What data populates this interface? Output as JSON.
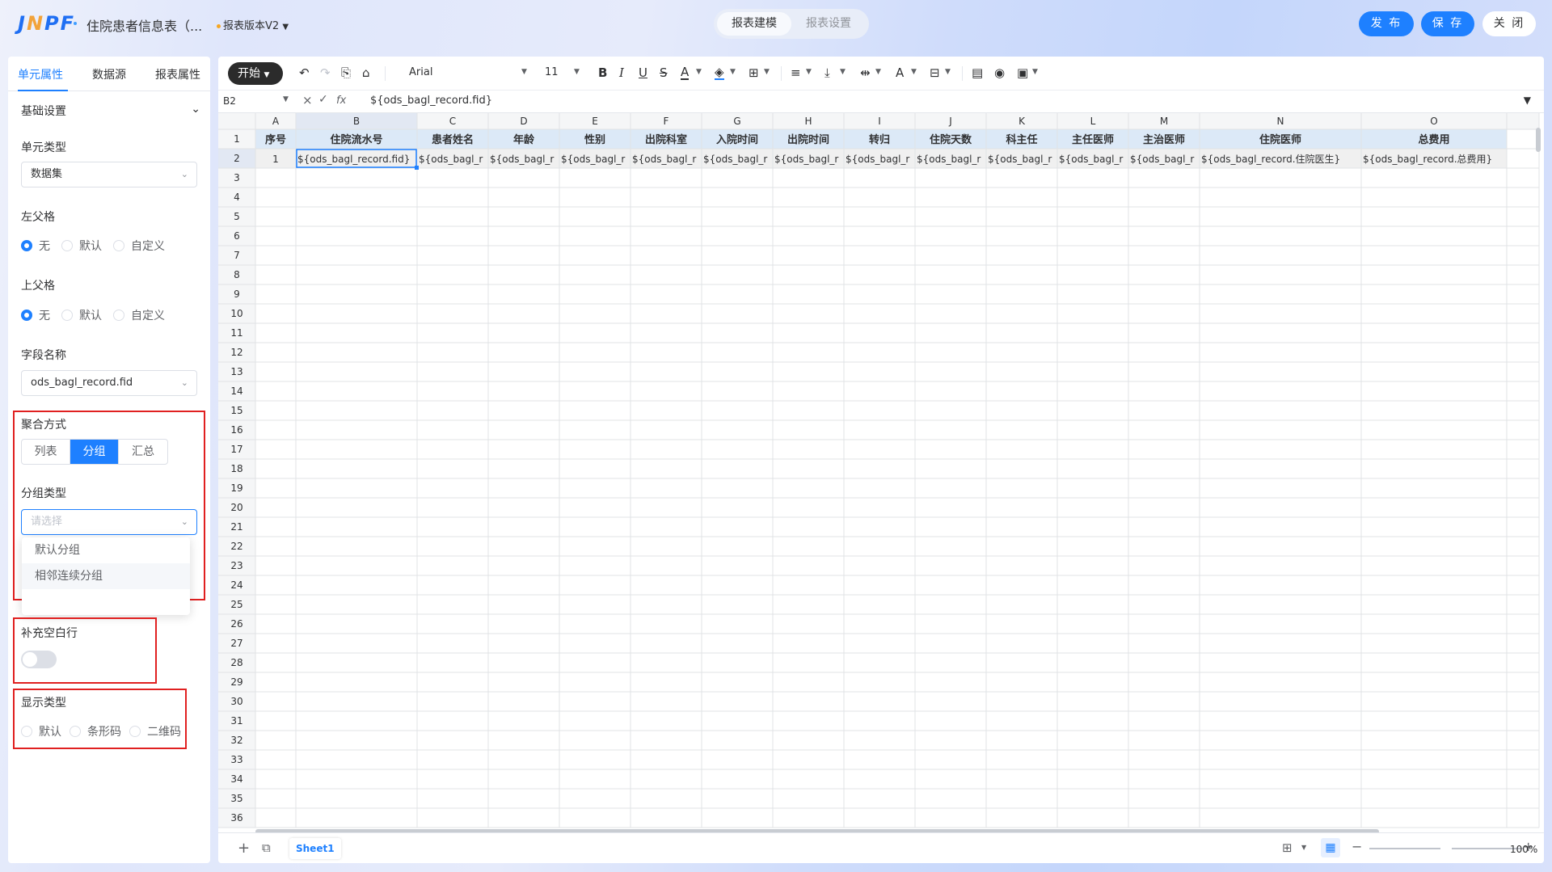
{
  "app": {
    "logo_prefix": "J",
    "logo_accent": "N",
    "logo_suffix": "PF",
    "doc_title": "住院患者信息表（...",
    "version_label": "报表版本V2",
    "mode_tabs": [
      "报表建模",
      "报表设置"
    ],
    "publish_label": "发 布",
    "save_label": "保 存",
    "close_label": "关 闭"
  },
  "left_panel": {
    "tabs": [
      "单元属性",
      "数据源",
      "报表属性"
    ],
    "section_title": "基础设置",
    "cell_type_label": "单元类型",
    "cell_type_value": "数据集",
    "left_parent_label": "左父格",
    "left_parent_options": [
      "无",
      "默认",
      "自定义"
    ],
    "top_parent_label": "上父格",
    "top_parent_options": [
      "无",
      "默认",
      "自定义"
    ],
    "field_name_label": "字段名称",
    "field_name_value": "ods_bagl_record.fid",
    "aggregate_label": "聚合方式",
    "aggregate_options": [
      "列表",
      "分组",
      "汇总"
    ],
    "group_type_label": "分组类型",
    "group_type_placeholder": "请选择",
    "group_type_options": [
      "默认分组",
      "相邻连续分组"
    ],
    "fill_blank_label": "补充空白行",
    "display_type_label": "显示类型",
    "display_type_options": [
      "默认",
      "条形码",
      "二维码"
    ]
  },
  "toolbar": {
    "start_label": "开始",
    "font_family": "Arial",
    "font_size": "11"
  },
  "formula_bar": {
    "cell_ref": "B2",
    "fx_label": "fx",
    "formula": "${ods_bagl_record.fid}"
  },
  "sheet": {
    "columns": [
      "A",
      "B",
      "C",
      "D",
      "E",
      "F",
      "G",
      "H",
      "I",
      "J",
      "K",
      "L",
      "M",
      "N",
      "O"
    ],
    "header_row": [
      "序号",
      "住院流水号",
      "患者姓名",
      "年龄",
      "性别",
      "出院科室",
      "入院时间",
      "出院时间",
      "转归",
      "住院天数",
      "科主任",
      "主任医师",
      "主治医师",
      "住院医师",
      "总费用"
    ],
    "data_row": [
      "1",
      "${ods_bagl_record.fid}",
      "${ods_bagl_r",
      "${ods_bagl_r",
      "${ods_bagl_r",
      "${ods_bagl_r",
      "${ods_bagl_r",
      "${ods_bagl_r",
      "${ods_bagl_r",
      "${ods_bagl_r",
      "${ods_bagl_r",
      "${ods_bagl_r",
      "${ods_bagl_r",
      "${ods_bagl_record.住院医生}",
      "${ods_bagl_record.总费用}"
    ],
    "row_numbers": [
      "1",
      "2",
      "3",
      "4",
      "5",
      "6",
      "7",
      "8",
      "9",
      "10",
      "11",
      "12",
      "13",
      "14",
      "15",
      "16",
      "17",
      "18",
      "19",
      "20",
      "21",
      "22",
      "23",
      "24",
      "25",
      "26",
      "27",
      "28",
      "29",
      "30",
      "31",
      "32",
      "33",
      "34",
      "35",
      "36"
    ],
    "tab_name": "Sheet1",
    "zoom": "100%"
  }
}
